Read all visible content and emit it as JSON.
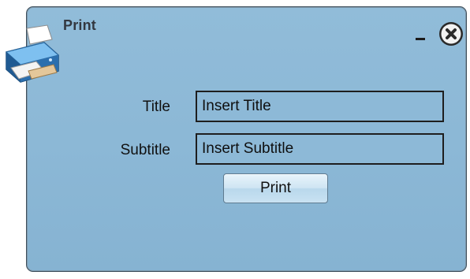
{
  "window": {
    "title": "Print"
  },
  "form": {
    "title_label": "Title",
    "title_value": "Insert Title",
    "subtitle_label": "Subtitle",
    "subtitle_value": "Insert Subtitle",
    "print_label": "Print"
  },
  "icons": {
    "app": "printer-icon",
    "minimize": "minimize-icon",
    "close": "close-icon",
    "resize": "resize-grip-icon"
  },
  "colors": {
    "dialog_bg": "#8cb8d6",
    "border": "#3e4f5c",
    "button_bg": "#cfe5f3",
    "text": "#111111"
  }
}
